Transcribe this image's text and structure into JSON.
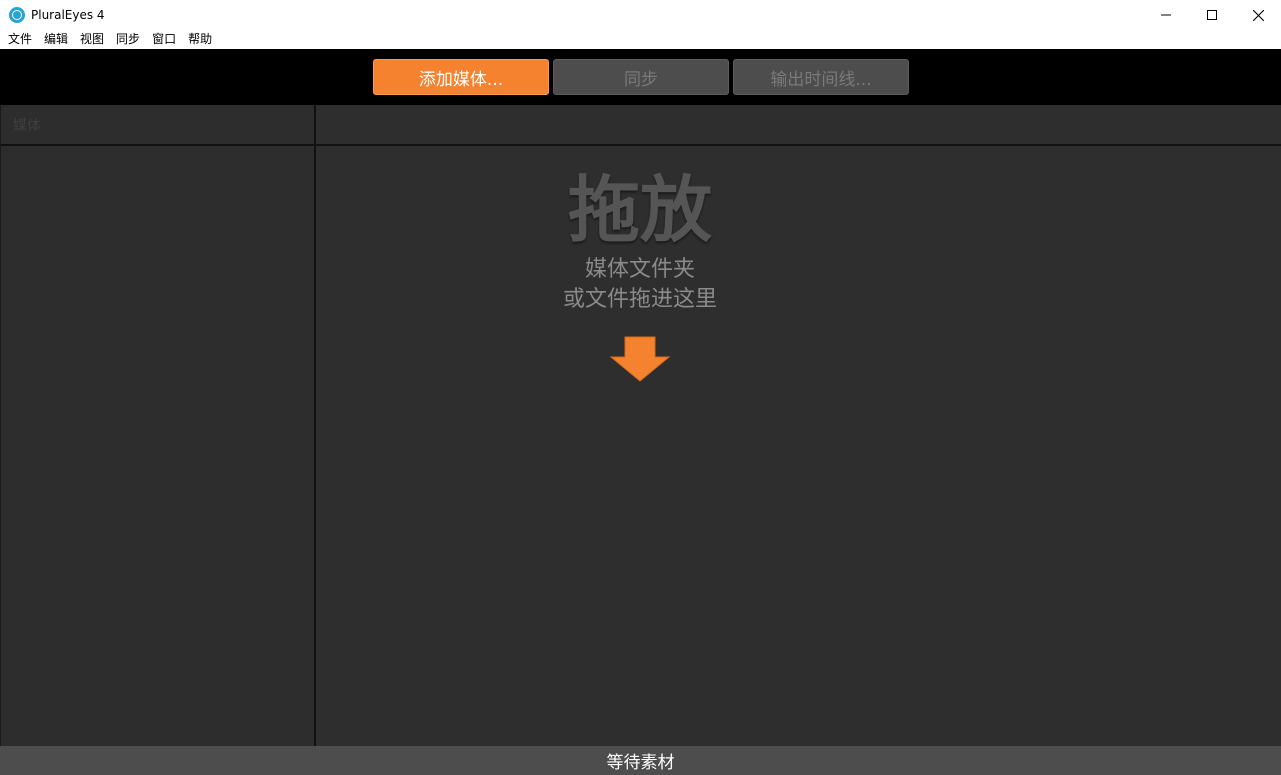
{
  "window": {
    "title": "PluralEyes 4",
    "icon": "plural-eyes-app-icon"
  },
  "menu": {
    "items": [
      {
        "label": "文件"
      },
      {
        "label": "编辑"
      },
      {
        "label": "视图"
      },
      {
        "label": "同步"
      },
      {
        "label": "窗口"
      },
      {
        "label": "帮助"
      }
    ]
  },
  "toolbar": {
    "add_media_label": "添加媒体...",
    "sync_label": "同步",
    "export_timeline_label": "输出时间线...",
    "accent_color": "#f5822e"
  },
  "left_panel": {
    "header_label": "媒体"
  },
  "drop_zone": {
    "title": "拖放",
    "line1": "媒体文件夹",
    "line2": "或文件拖进这里",
    "arrow_icon": "down-arrow-icon"
  },
  "status": {
    "text": "等待素材"
  }
}
